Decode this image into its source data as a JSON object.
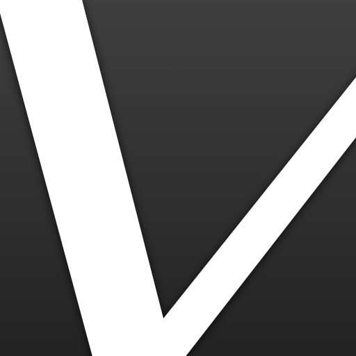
{
  "icon": {
    "name": "v-logo-icon",
    "letter": "V",
    "colors": {
      "background_top": "#3f3f3f",
      "background_bottom": "#232323",
      "mark": "#ffffff",
      "shadow": "#000000"
    }
  }
}
